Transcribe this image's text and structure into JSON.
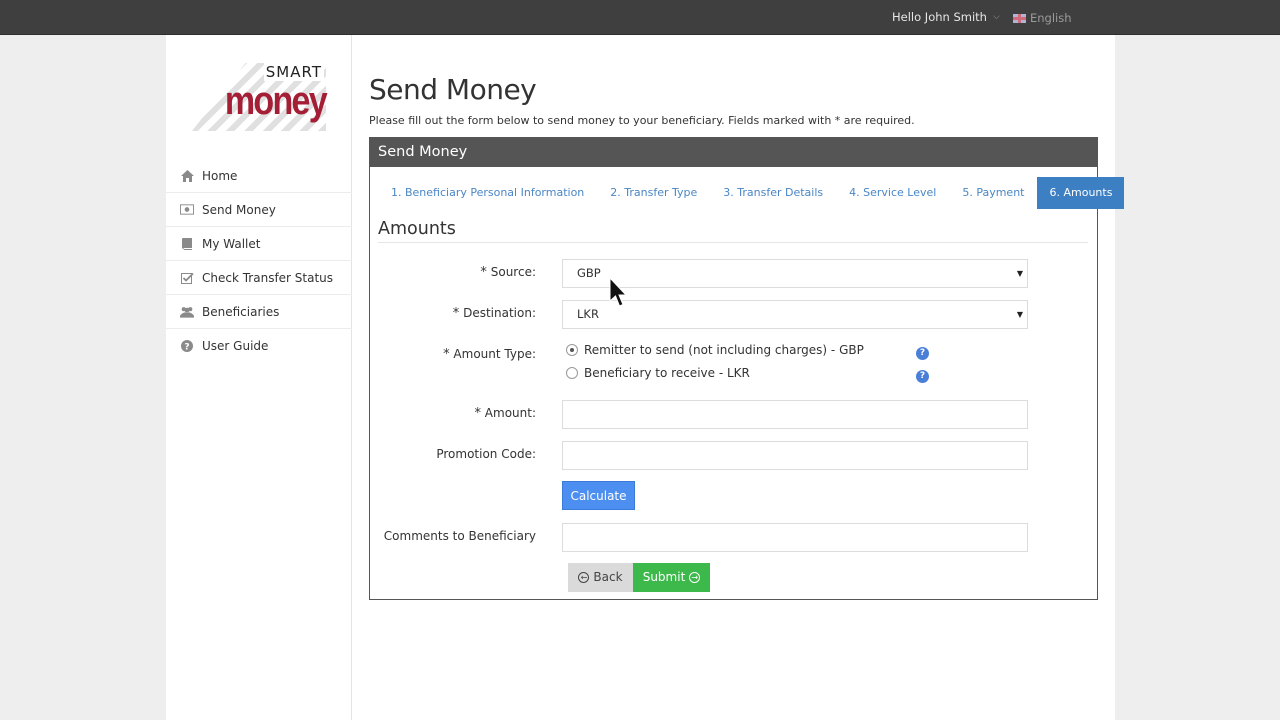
{
  "topbar": {
    "greeting": "Hello John Smith",
    "language": "English"
  },
  "logo": {
    "line1": "SMART",
    "line2": "money"
  },
  "sidebar": {
    "items": [
      {
        "label": "Home",
        "icon": "home-icon"
      },
      {
        "label": "Send Money",
        "icon": "money-icon"
      },
      {
        "label": "My Wallet",
        "icon": "wallet-icon"
      },
      {
        "label": "Check Transfer Status",
        "icon": "check-icon"
      },
      {
        "label": "Beneficiaries",
        "icon": "users-icon"
      },
      {
        "label": "User Guide",
        "icon": "question-icon"
      }
    ]
  },
  "main": {
    "title": "Send Money",
    "subtitle": "Please fill out the form below to send money to your beneficiary. Fields marked with * are required.",
    "panel_title": "Send Money",
    "steps": [
      {
        "label": "1. Beneficiary Personal Information",
        "active": false
      },
      {
        "label": "2. Transfer Type",
        "active": false
      },
      {
        "label": "3. Transfer Details",
        "active": false
      },
      {
        "label": "4. Service Level",
        "active": false
      },
      {
        "label": "5. Payment",
        "active": false
      },
      {
        "label": "6. Amounts",
        "active": true
      }
    ],
    "section_title": "Amounts"
  },
  "form": {
    "source_label": "Source:",
    "source_value": "GBP",
    "destination_label": "Destination:",
    "destination_value": "LKR",
    "amount_type_label": "Amount Type:",
    "amount_type_options": [
      {
        "label": "Remitter to send (not including charges) - GBP",
        "checked": true
      },
      {
        "label": "Beneficiary to receive - LKR",
        "checked": false
      }
    ],
    "amount_label": "Amount:",
    "amount_value": "",
    "promo_label": "Promotion Code:",
    "promo_value": "",
    "calculate_label": "Calculate",
    "comments_label": "Comments to Beneficiary",
    "comments_value": "",
    "back_label": "Back",
    "submit_label": "Submit",
    "required_mark": "*",
    "help_glyph": "?"
  },
  "colors": {
    "topbar": "#3f3f3f",
    "panel_header": "#555555",
    "active_step": "#3c7fc2",
    "step_link": "#4a86c5",
    "calculate": "#4d8ff0",
    "submit": "#3cb94a",
    "brand_red": "#a41e36"
  }
}
